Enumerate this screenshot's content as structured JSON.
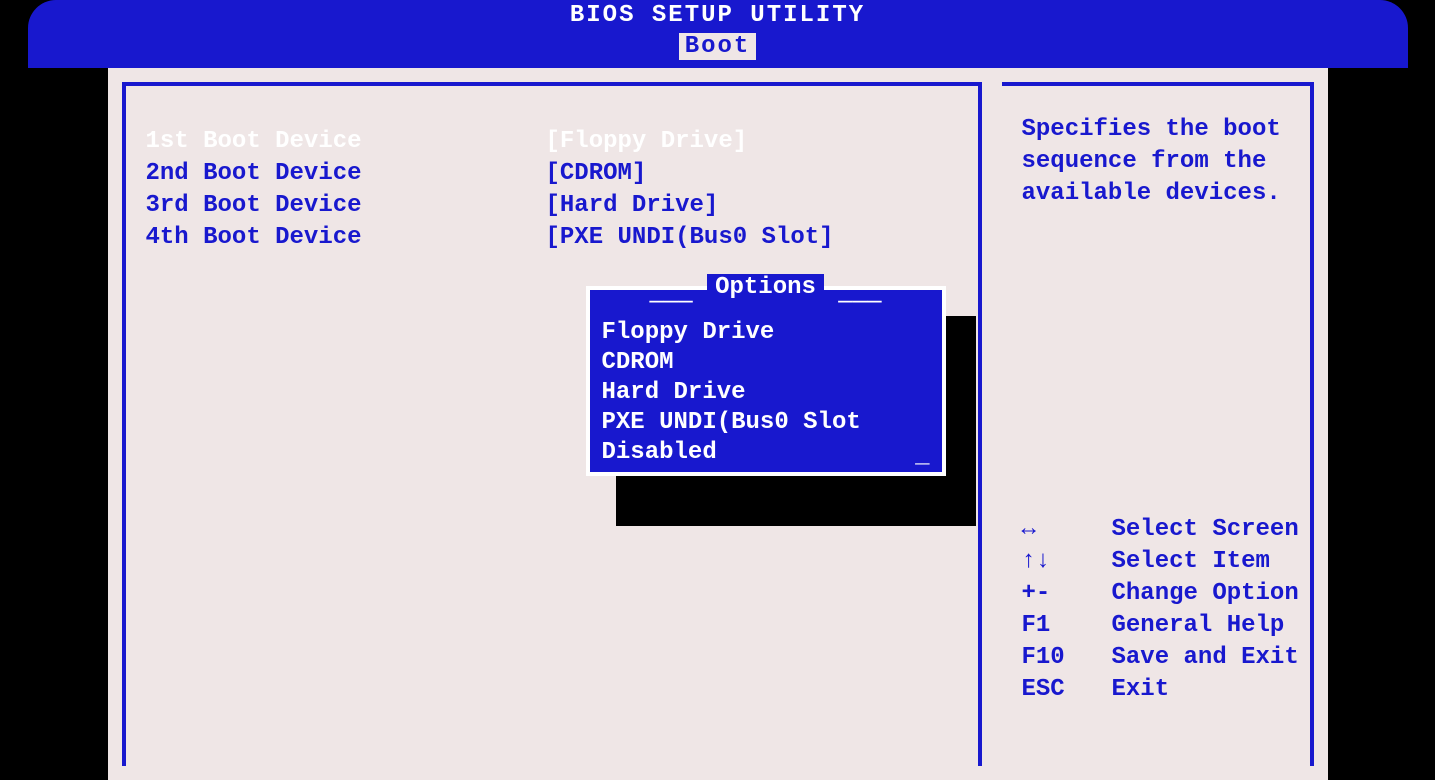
{
  "header": {
    "title": "BIOS SETUP UTILITY",
    "active_tab": "Boot"
  },
  "boot_devices": [
    {
      "label": "1st Boot Device",
      "value": "[Floppy Drive]",
      "selected": true
    },
    {
      "label": "2nd Boot Device",
      "value": "[CDROM]",
      "selected": false
    },
    {
      "label": "3rd Boot Device",
      "value": "[Hard Drive]",
      "selected": false
    },
    {
      "label": "4th Boot Device",
      "value": "[PXE UNDI(Bus0 Slot]",
      "selected": false
    }
  ],
  "options_popup": {
    "title": "Options",
    "items": [
      "Floppy Drive",
      "CDROM",
      "Hard Drive",
      "PXE UNDI(Bus0 Slot",
      "Disabled"
    ]
  },
  "side": {
    "help_text": "Specifies the boot sequence from the available devices.",
    "keys": [
      {
        "key": "↔",
        "desc": "Select Screen"
      },
      {
        "key": "↑↓",
        "desc": "Select Item"
      },
      {
        "key": "+-",
        "desc": "Change Option"
      },
      {
        "key": "F1",
        "desc": "General Help"
      },
      {
        "key": "F10",
        "desc": "Save and Exit"
      },
      {
        "key": "ESC",
        "desc": "Exit"
      }
    ]
  }
}
